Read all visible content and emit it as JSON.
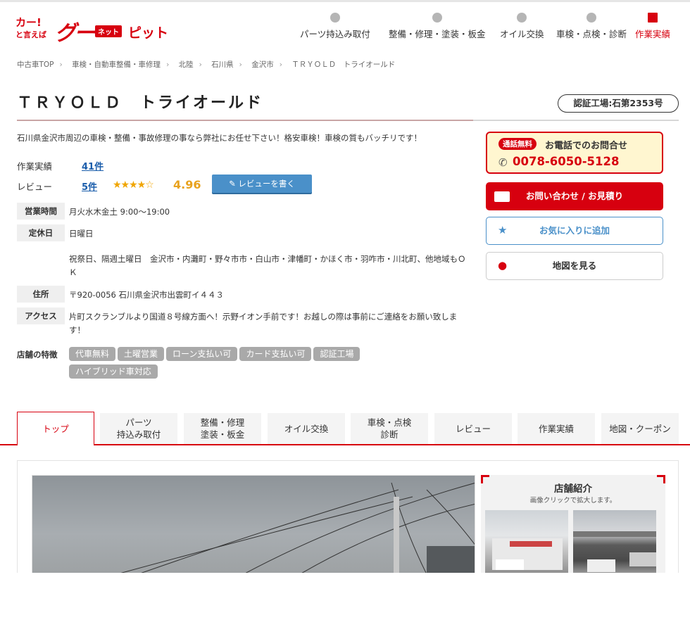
{
  "header": {
    "logo": {
      "line1": "カー!",
      "line2": "と言えば",
      "goo": "グー",
      "net": "ネット",
      "pit": "ピット"
    },
    "nav": [
      {
        "label": "パーツ持込み取付",
        "icon": "parts-icon"
      },
      {
        "label": "整備・修理・塗装・板金",
        "icon": "wrench-icon"
      },
      {
        "label": "オイル交換",
        "icon": "oil-drop-icon"
      },
      {
        "label": "車検・点検・診断",
        "icon": "inspection-icon"
      },
      {
        "label": "作業実績",
        "icon": "factory-icon"
      }
    ]
  },
  "breadcrumb": [
    "中古車TOP",
    "車検・自動車整備・車修理",
    "北陸",
    "石川県",
    "金沢市",
    "ＴＲＹＯＬＤ　トライオールド"
  ],
  "shop": {
    "title": "ＴＲＹＯＬＤ　トライオールド",
    "certification": "認証工場:石第2353号",
    "description": "石川県金沢市周辺の車検・整備・事故修理の事なら弊社にお任せ下さい！格安車検！車検の質もバッチリです！",
    "work_label": "作業実績",
    "work_count": "41件",
    "review_label": "レビュー",
    "review_count": "5件",
    "stars": "★★★★☆",
    "rating": "4.96",
    "review_button": "レビューを書く"
  },
  "info": {
    "hours_label": "営業時間",
    "hours": "月火水木金土 9:00〜19:00",
    "holiday_label": "定休日",
    "holiday": "日曜日",
    "holiday_note": "祝祭日、隔週土曜日　金沢市・内灘町・野々市市・白山市・津幡町・かほく市・羽咋市・川北町、他地域もＯＫ",
    "address_label": "住所",
    "address": "〒920-0056 石川県金沢市出雲町イ４４３",
    "access_label": "アクセス",
    "access": "片町スクランブルより国道８号線方面へ！示野イオン手前です！お越しの際は事前にご連絡をお願い致します！",
    "features_label": "店舗の特徴",
    "features": [
      "代車無料",
      "土曜営業",
      "ローン支払い可",
      "カード支払い可",
      "認証工場",
      "ハイブリッド車対応"
    ]
  },
  "contact": {
    "free_badge": "通話無料",
    "call_title": "お電話でのお問合せ",
    "phone": "0078-6050-5128",
    "inquiry_button": "お問い合わせ / お見積り",
    "favorite_button": "お気に入りに追加",
    "map_button": "地図を見る"
  },
  "tabs": [
    {
      "line1": "トップ",
      "line2": ""
    },
    {
      "line1": "パーツ",
      "line2": "持込み取付"
    },
    {
      "line1": "整備・修理",
      "line2": "塗装・板金"
    },
    {
      "line1": "オイル交換",
      "line2": ""
    },
    {
      "line1": "車検・点検",
      "line2": "診断"
    },
    {
      "line1": "レビュー",
      "line2": ""
    },
    {
      "line1": "作業実績",
      "line2": ""
    },
    {
      "line1": "地図・クーポン",
      "line2": ""
    }
  ],
  "intro": {
    "title": "店舗紹介",
    "subtitle": "画像クリックで拡大します。"
  },
  "colors": {
    "brand": "#d7000f",
    "link": "#1a5dab",
    "accent_blue": "#4a90c9",
    "star": "#f0a500"
  }
}
